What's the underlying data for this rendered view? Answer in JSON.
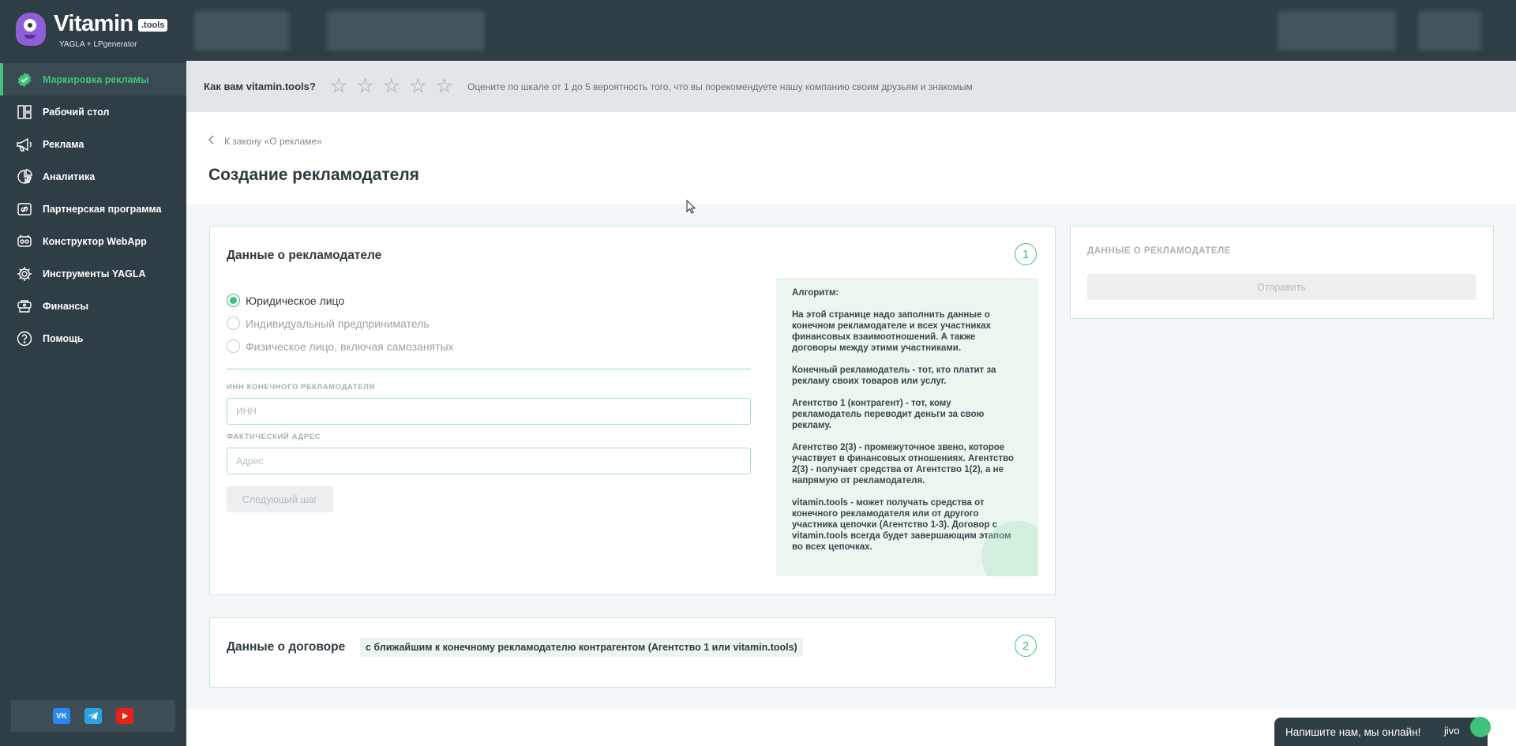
{
  "app": {
    "logo_title": "Vitamin",
    "logo_badge": ".tools",
    "logo_sub": "YAGLA + LPgenerator"
  },
  "sidebar": {
    "items": [
      {
        "label": "Маркировка рекламы",
        "icon": "check-badge-icon",
        "active": true
      },
      {
        "label": "Рабочий стол",
        "icon": "dashboard-icon",
        "active": false
      },
      {
        "label": "Реклама",
        "icon": "megaphone-icon",
        "active": false
      },
      {
        "label": "Аналитика",
        "icon": "analytics-icon",
        "active": false
      },
      {
        "label": "Партнерская программа",
        "icon": "link-icon",
        "active": false
      },
      {
        "label": "Конструктор WebApp",
        "icon": "webapp-icon",
        "active": false
      },
      {
        "label": "Инструменты YAGLA",
        "icon": "gear-icon",
        "active": false
      },
      {
        "label": "Финансы",
        "icon": "wallet-icon",
        "active": false
      },
      {
        "label": "Помощь",
        "icon": "help-icon",
        "active": false
      }
    ],
    "social": [
      "vk-icon",
      "telegram-icon",
      "youtube-icon"
    ]
  },
  "rating": {
    "question": "Как вам vitamin.tools?",
    "hint": "Оцените по шкале от 1 до 5 вероятность того, что вы порекомендуете нашу компанию своим друзьям и знакомым",
    "stars": 5
  },
  "header": {
    "back_label": "К закону «О рекламе»",
    "title": "Создание рекламодателя"
  },
  "advertiser_card": {
    "title": "Данные о рекламодателе",
    "step": "1",
    "radios": [
      {
        "label": "Юридическое лицо",
        "selected": true
      },
      {
        "label": "Индивидуальный предприниматель",
        "selected": false
      },
      {
        "label": "Физическое лицо, включая самозанятых",
        "selected": false
      }
    ],
    "inn_label": "ИНН КОНЕЧНОГО РЕКЛАМОДАТЕЛЯ",
    "inn_placeholder": "ИНН",
    "inn_value": "",
    "address_label": "ФАКТИЧЕСКИЙ АДРЕС",
    "address_placeholder": "Адрес",
    "address_value": "",
    "next_button": "Следующий шаг",
    "algorithm": {
      "title": "Алгоритм:",
      "paragraphs": [
        "На этой странице надо заполнить данные о конечном рекламодателе и всех участниках финансовых взаимоотношений. А также договоры между этими участниками.",
        "Конечный рекламодатель - тот, кто платит за рекламу своих товаров или услуг.",
        "Агентство 1 (контрагент) - тот, кому рекламодатель переводит деньги за свою рекламу.",
        "Агентство 2(3) - промежуточное звено, которое участвует в финансовых отношениях. Агентство 2(3) - получает средства от Агентство 1(2), а не напрямую от рекламодателя.",
        "vitamin.tools - может получать средства от конечного рекламодателя или от другого участника цепочки (Агентство 1-3). Договор с vitamin.tools всегда будет завершающим этапом во всех цепочках."
      ]
    }
  },
  "contract_card": {
    "title": "Данные о договоре",
    "tag": "с ближайшим к конечному рекламодателю контрагентом (Агентство 1 или vitamin.tools)",
    "step": "2"
  },
  "summary_card": {
    "title": "ДАННЫЕ О РЕКЛАМОДАТЕЛЕ",
    "send_button": "Отправить"
  },
  "chat": {
    "text": "Напишите нам, мы онлайн!",
    "brand": "jivo"
  },
  "colors": {
    "sidebar_bg": "#2f3e45",
    "accent_green": "#3fc27a",
    "rating_bg": "#e3e6e8"
  }
}
